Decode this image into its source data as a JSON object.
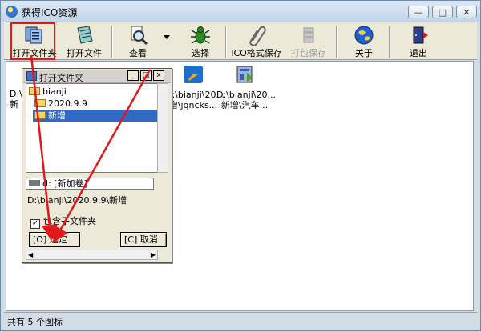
{
  "window": {
    "title": "获得ICO资源",
    "controls": [
      "minimize",
      "maximize",
      "close"
    ]
  },
  "toolbar": {
    "open_folder": "打开文件夹",
    "open_file": "打开文件",
    "view": "查看",
    "select": "选择",
    "ico_save": "ICO格式保存",
    "pack_save": "打包保存",
    "about": "关于",
    "exit": "退出"
  },
  "files": {
    "item1_line1": "D:\\",
    "item1_line2": "新",
    "item2_line1": "D:\\bianji\\20...",
    "item2_line2": "增\\jqncks...",
    "item3_line1": "D:\\bianji\\20...",
    "item3_line2": "新增\\汽车..."
  },
  "status": {
    "text": "共有 5 个图标"
  },
  "dialog": {
    "title": "打开文件夹",
    "tree": [
      "bianji",
      "2020.9.9",
      "新增"
    ],
    "drive": "d: [新加卷]",
    "path": "D:\\bianji\\2020.9.9\\新增",
    "include_subfolders": "包含子文件夹",
    "ok_button": "[O] 选定",
    "cancel_button": "[C] 取消"
  },
  "colors": {
    "annotation": "#e01a1a",
    "selection": "#316ac5"
  },
  "icons": {
    "app": "globe-icon",
    "open_folder": "folder-copy-icon",
    "open_file": "notebook-icon",
    "view": "magnifier-icon",
    "select": "bug-icon",
    "ico_save": "paperclip-icon",
    "pack_save": "archive-icon",
    "about": "globe-icon",
    "exit": "door-icon"
  }
}
